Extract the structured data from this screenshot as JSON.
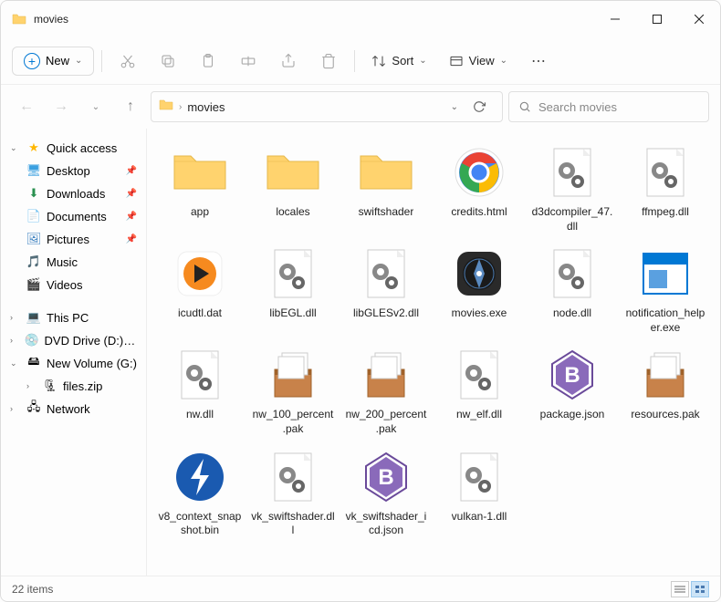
{
  "window": {
    "title": "movies"
  },
  "toolbar": {
    "new_label": "New",
    "sort_label": "Sort",
    "view_label": "View"
  },
  "breadcrumb": {
    "location": "movies"
  },
  "search": {
    "placeholder": "Search movies"
  },
  "sidebar": {
    "quick_access": "Quick access",
    "desktop": "Desktop",
    "downloads": "Downloads",
    "documents": "Documents",
    "pictures": "Pictures",
    "music": "Music",
    "videos": "Videos",
    "this_pc": "This PC",
    "dvd": "DVD Drive (D:) CCCC",
    "new_volume": "New Volume (G:)",
    "files_zip": "files.zip",
    "network": "Network"
  },
  "files": [
    {
      "name": "app",
      "type": "folder"
    },
    {
      "name": "locales",
      "type": "folder"
    },
    {
      "name": "swiftshader",
      "type": "folder"
    },
    {
      "name": "credits.html",
      "type": "chrome"
    },
    {
      "name": "d3dcompiler_47.dll",
      "type": "dll"
    },
    {
      "name": "ffmpeg.dll",
      "type": "dll"
    },
    {
      "name": "icudtl.dat",
      "type": "player"
    },
    {
      "name": "libEGL.dll",
      "type": "dll"
    },
    {
      "name": "libGLESv2.dll",
      "type": "dll"
    },
    {
      "name": "movies.exe",
      "type": "compass"
    },
    {
      "name": "node.dll",
      "type": "dll"
    },
    {
      "name": "notification_helper.exe",
      "type": "window"
    },
    {
      "name": "nw.dll",
      "type": "dll"
    },
    {
      "name": "nw_100_percent.pak",
      "type": "pak"
    },
    {
      "name": "nw_200_percent.pak",
      "type": "pak"
    },
    {
      "name": "nw_elf.dll",
      "type": "dll"
    },
    {
      "name": "package.json",
      "type": "bbedit"
    },
    {
      "name": "resources.pak",
      "type": "pak"
    },
    {
      "name": "v8_context_snapshot.bin",
      "type": "bolt"
    },
    {
      "name": "vk_swiftshader.dll",
      "type": "dll"
    },
    {
      "name": "vk_swiftshader_icd.json",
      "type": "bbedit"
    },
    {
      "name": "vulkan-1.dll",
      "type": "dll"
    }
  ],
  "status": {
    "item_count": "22 items"
  }
}
